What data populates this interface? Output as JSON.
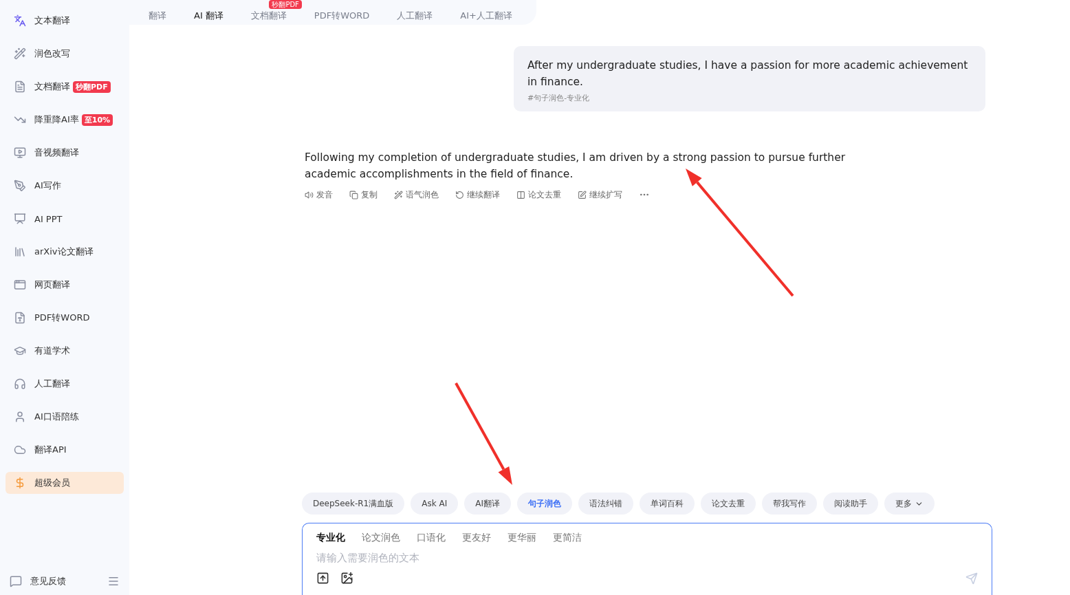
{
  "sidebar": {
    "items": [
      {
        "label": "文本翻译",
        "selected": false
      },
      {
        "label": "润色改写",
        "selected": false
      },
      {
        "label": "文档翻译",
        "badge": "秒翻PDF",
        "selected": false
      },
      {
        "label": "降重降AI率",
        "badge": "至10%",
        "selected": false
      },
      {
        "label": "音视频翻译",
        "selected": false
      },
      {
        "label": "AI写作",
        "selected": false
      },
      {
        "label": "AI PPT",
        "selected": false
      },
      {
        "label": "arXiv论文翻译",
        "selected": false
      },
      {
        "label": "网页翻译",
        "selected": false
      },
      {
        "label": "PDF转WORD",
        "selected": false
      },
      {
        "label": "有道学术",
        "selected": false
      },
      {
        "label": "人工翻译",
        "selected": false
      },
      {
        "label": "AI口语陪练",
        "selected": false
      },
      {
        "label": "翻译API",
        "selected": false
      },
      {
        "label": "超级会员",
        "selected": true
      }
    ],
    "footer": {
      "label": "意见反馈"
    }
  },
  "tabs": [
    {
      "label": "翻译",
      "selected": false
    },
    {
      "label": "AI 翻译",
      "selected": true
    },
    {
      "label": "文档翻译",
      "badge": "秒翻PDF",
      "selected": false
    },
    {
      "label": "PDF转WORD",
      "selected": false
    },
    {
      "label": "人工翻译",
      "selected": false
    },
    {
      "label": "AI+人工翻译",
      "selected": false
    }
  ],
  "user_message": {
    "text": "After my undergraduate studies, I have a passion for more academic achievement in finance.",
    "tag": "#句子润色-专业化"
  },
  "response": {
    "text": "Following my completion of undergraduate studies, I am driven by a strong passion to pursue further academic accomplishments in the field of finance.",
    "actions": [
      "发音",
      "复制",
      "语气润色",
      "继续翻译",
      "论文去重",
      "继续扩写"
    ]
  },
  "chips": [
    {
      "label": "DeepSeek-R1满血版",
      "selected": false
    },
    {
      "label": "Ask AI",
      "selected": false
    },
    {
      "label": "AI翻译",
      "selected": false
    },
    {
      "label": "句子润色",
      "selected": true
    },
    {
      "label": "语法纠错",
      "selected": false
    },
    {
      "label": "单词百科",
      "selected": false
    },
    {
      "label": "论文去重",
      "selected": false
    },
    {
      "label": "帮我写作",
      "selected": false
    },
    {
      "label": "阅读助手",
      "selected": false
    },
    {
      "label": "更多",
      "selected": false
    }
  ],
  "input": {
    "styles": [
      {
        "label": "专业化",
        "selected": true
      },
      {
        "label": "论文润色",
        "selected": false
      },
      {
        "label": "口语化",
        "selected": false
      },
      {
        "label": "更友好",
        "selected": false
      },
      {
        "label": "更华丽",
        "selected": false
      },
      {
        "label": "更简洁",
        "selected": false
      }
    ],
    "placeholder": "请输入需要润色的文本"
  }
}
